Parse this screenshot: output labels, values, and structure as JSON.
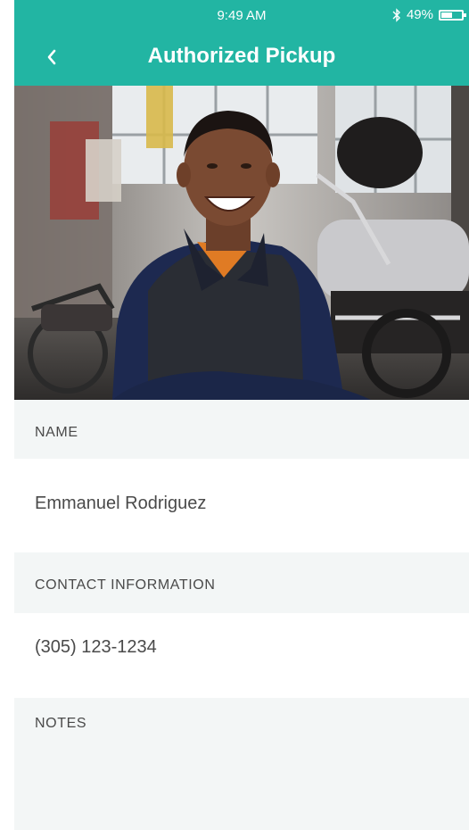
{
  "status_bar": {
    "time": "9:49 AM",
    "battery": "49%"
  },
  "header": {
    "title": "Authorized Pickup"
  },
  "photo": {
    "subject": "smiling man in garage with motorcycles"
  },
  "sections": {
    "name": {
      "label": "NAME",
      "value": "Emmanuel Rodriguez"
    },
    "contact": {
      "label": "CONTACT INFORMATION",
      "value": "(305) 123-1234"
    },
    "notes": {
      "label": "NOTES",
      "value": ""
    }
  },
  "colors": {
    "accent": "#22b5a3",
    "section_bg": "#f3f6f6",
    "text": "#4a4a4a"
  }
}
